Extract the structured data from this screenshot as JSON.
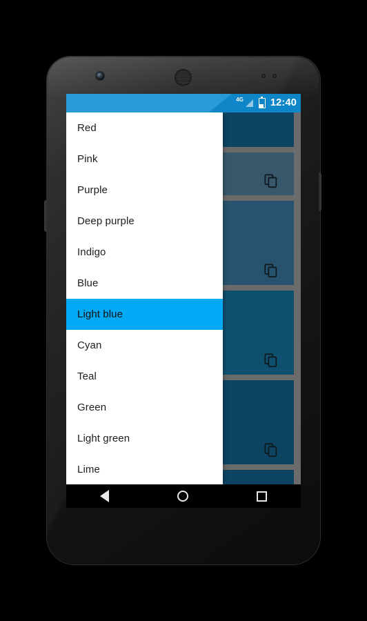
{
  "device": {
    "name": "android-phone",
    "camera_icon": "front-camera-icon",
    "speaker_icon": "earpiece-speaker-icon"
  },
  "status_bar": {
    "network_label": "4G",
    "signal_icon": "signal-bars-icon",
    "battery_icon": "battery-icon",
    "time": "12:40",
    "background_color": "#0f86c8",
    "accent_color": "#2a9ad6"
  },
  "dropdown": {
    "name": "color-spinner-dropdown",
    "selected": "Light blue",
    "highlight_color": "#03a9f4",
    "items": [
      {
        "label": "Red",
        "selected": false
      },
      {
        "label": "Pink",
        "selected": false
      },
      {
        "label": "Purple",
        "selected": false
      },
      {
        "label": "Deep purple",
        "selected": false
      },
      {
        "label": "Indigo",
        "selected": false
      },
      {
        "label": "Blue",
        "selected": false
      },
      {
        "label": "Light blue",
        "selected": true
      },
      {
        "label": "Cyan",
        "selected": false
      },
      {
        "label": "Teal",
        "selected": false
      },
      {
        "label": "Green",
        "selected": false
      },
      {
        "label": "Light green",
        "selected": false
      },
      {
        "label": "Lime",
        "selected": false
      }
    ]
  },
  "cards": {
    "name": "card-list",
    "background_color": "#6b6b6b",
    "items": [
      {
        "height": 50,
        "color": "#0d4462",
        "icon": null
      },
      {
        "height": 62,
        "color": "#39576b",
        "icon": "copy-icon"
      },
      {
        "height": 122,
        "color": "#27536e",
        "icon": "copy-icon"
      },
      {
        "height": 122,
        "color": "#10506f",
        "icon": "copy-icon"
      },
      {
        "height": 122,
        "color": "#0d4462",
        "icon": "copy-icon"
      },
      {
        "height": 50,
        "color": "#0d4462",
        "icon": null
      }
    ]
  },
  "nav_bar": {
    "background_color": "#000000",
    "buttons": [
      {
        "name": "back-button",
        "icon": "triangle-back-icon"
      },
      {
        "name": "home-button",
        "icon": "circle-home-icon"
      },
      {
        "name": "recents-button",
        "icon": "square-recents-icon"
      }
    ]
  }
}
